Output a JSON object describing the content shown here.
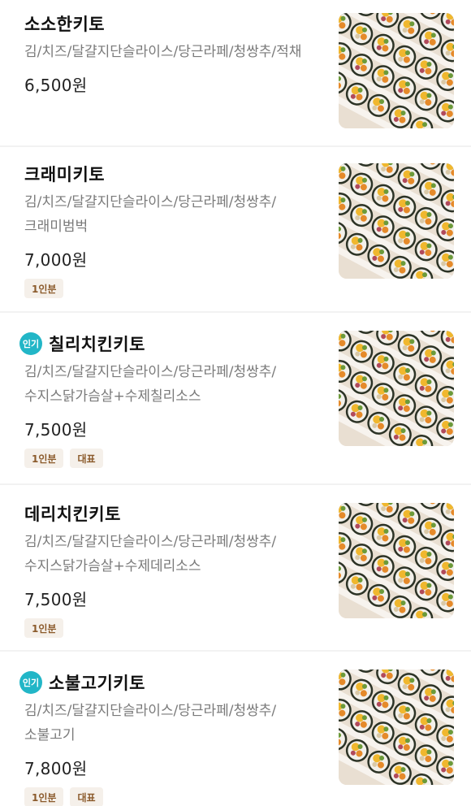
{
  "menu_items": [
    {
      "name": "소소한키토",
      "hot": false,
      "desc_lines": [
        "김/치즈/달걀지단슬라이스/당근라페/청쌍추/적채"
      ],
      "price": "6,500원",
      "tags": []
    },
    {
      "name": "크래미키토",
      "hot": false,
      "desc_lines": [
        "김/치즈/달걀지단슬라이스/당근라페/청쌍추/",
        "크래미범벅"
      ],
      "price": "7,000원",
      "tags": [
        "1인분"
      ]
    },
    {
      "name": "칠리치킨키토",
      "hot": true,
      "hot_label": "인기",
      "desc_lines": [
        "김/치즈/달걀지단슬라이스/당근라페/청쌍추/",
        "수지스닭가슴살+수제칠리소스"
      ],
      "price": "7,500원",
      "tags": [
        "1인분",
        "대표"
      ]
    },
    {
      "name": "데리치킨키토",
      "hot": false,
      "desc_lines": [
        "김/치즈/달걀지단슬라이스/당근라페/청쌍추/",
        "수지스닭가슴살+수제데리소스"
      ],
      "price": "7,500원",
      "tags": [
        "1인분"
      ]
    },
    {
      "name": "소불고기키토",
      "hot": true,
      "hot_label": "인기",
      "desc_lines": [
        "김/치즈/달걀지단슬라이스/당근라페/청쌍추/",
        "소불고기"
      ],
      "price": "7,800원",
      "tags": [
        "1인분",
        "대표"
      ]
    }
  ],
  "colors": {
    "hot_badge": "#22b6c7",
    "tag_bg": "#f5f0ea",
    "tag_text": "#8b5a2b",
    "desc_text": "#7a7a7a"
  },
  "icons": {
    "thumbnail": "kimbap-photo"
  }
}
